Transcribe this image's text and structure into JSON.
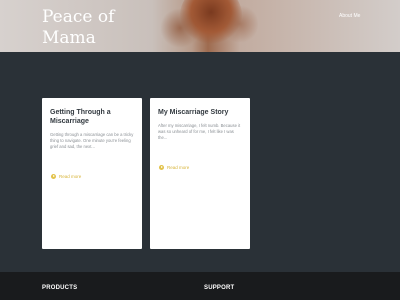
{
  "header": {
    "site_title": "Peace of Mama",
    "nav": [
      {
        "label": "About Me"
      }
    ]
  },
  "posts": [
    {
      "title": "Getting Through a Miscarriage",
      "excerpt": "Getting through a miscarriage can be a tricky thing to navigate. One minute you're feeling grief and sad, the next...",
      "read_more": "Read more"
    },
    {
      "title": "My Miscarriage Story",
      "excerpt": "After my miscarriage, I felt numb. Because it was so unheard of for me, I felt like I was the...",
      "read_more": "Read more"
    }
  ],
  "footer": {
    "headings": [
      "PRODUCTS",
      "SUPPORT"
    ]
  },
  "colors": {
    "page_background": "#2a3137",
    "card_background": "#ffffff",
    "accent": "#d8b53a",
    "footer_background": "#191b1d"
  }
}
